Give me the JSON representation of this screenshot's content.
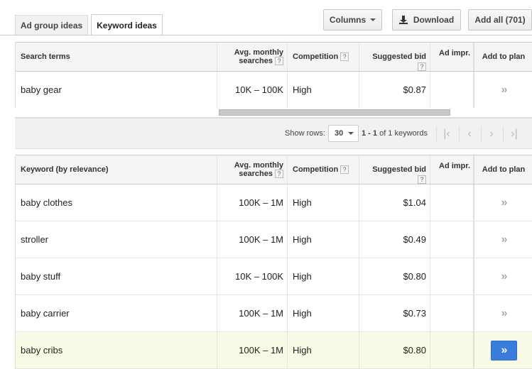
{
  "tabs": [
    {
      "label": "Ad group ideas",
      "active": false
    },
    {
      "label": "Keyword ideas",
      "active": true
    }
  ],
  "toolbar": {
    "columns_label": "Columns",
    "download_label": "Download",
    "add_all_label": "Add all (701)"
  },
  "search_terms_table": {
    "headers": {
      "keyword": "Search terms",
      "avg_line1": "Avg. monthly",
      "avg_line2": "searches",
      "competition": "Competition",
      "bid": "Suggested bid",
      "impr": "Ad impr.",
      "add": "Add to plan"
    },
    "rows": [
      {
        "keyword": "baby gear",
        "avg": "10K – 100K",
        "competition": "High",
        "bid": "$0.87"
      }
    ]
  },
  "pager": {
    "show_rows_label": "Show rows:",
    "rows_value": "30",
    "count_prefix": "1 - 1",
    "count_suffix": "of 1 keywords"
  },
  "keyword_ideas_table": {
    "headers": {
      "keyword": "Keyword (by relevance)",
      "avg_line1": "Avg. monthly",
      "avg_line2": "searches",
      "competition": "Competition",
      "bid": "Suggested bid",
      "impr": "Ad impr.",
      "add": "Add to plan"
    },
    "rows": [
      {
        "keyword": "baby clothes",
        "avg": "100K – 1M",
        "competition": "High",
        "bid": "$1.04"
      },
      {
        "keyword": "stroller",
        "avg": "100K – 1M",
        "competition": "High",
        "bid": "$0.49"
      },
      {
        "keyword": "baby stuff",
        "avg": "10K – 100K",
        "competition": "High",
        "bid": "$0.80"
      },
      {
        "keyword": "baby carrier",
        "avg": "100K – 1M",
        "competition": "High",
        "bid": "$0.73"
      },
      {
        "keyword": "baby cribs",
        "avg": "100K – 1M",
        "competition": "High",
        "bid": "$0.80"
      }
    ]
  },
  "help_mark": "?",
  "icons": {
    "add_chevron": "»",
    "first_page": "|‹",
    "prev_page": "‹",
    "next_page": "›",
    "last_page": "›|"
  },
  "colors": {
    "accent_blue": "#3b7ddd",
    "highlight_row": "#fafbe6"
  }
}
